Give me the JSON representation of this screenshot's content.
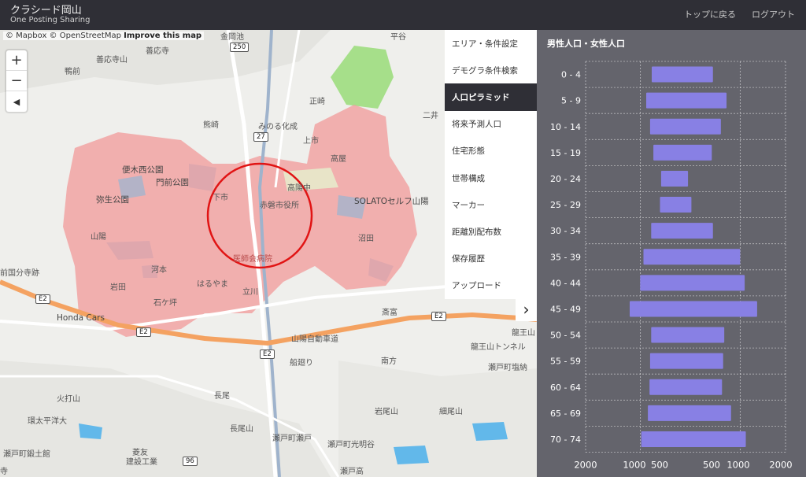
{
  "header": {
    "title": "クラシード岡山",
    "subtitle": "One Posting Sharing",
    "nav": [
      "トップに戻る",
      "ログアウト"
    ]
  },
  "map": {
    "attribution": {
      "mapbox": "© Mapbox",
      "osm": "© OpenStreetMap",
      "improve": "Improve this map"
    },
    "zoom": {
      "in": "+",
      "out": "−",
      "compass": "◀"
    },
    "labels": {
      "l1": "善応寺山",
      "l2": "善応寺",
      "l3": "鴨前",
      "l4": "250",
      "l5": "正崎",
      "l6": "熊崎",
      "l7": "みのる化成",
      "l8": "27",
      "l9": "上市",
      "l10": "高屋",
      "l11": "便木西公園",
      "l12": "門前公園",
      "l13": "弥生公園",
      "l14": "下市",
      "l15": "赤磐市役所",
      "l16": "高陽中",
      "l17": "SOLATOセルフ山陽",
      "l18": "山陽",
      "l19": "沼田",
      "l20": "河本",
      "l21": "医師会病院",
      "l22": "岩田",
      "l23": "はるやま",
      "l24": "前国分寺跡",
      "l25": "E2",
      "l26": "石ケ坪",
      "l27": "立川",
      "l28": "Honda Cars",
      "l29": "斎富",
      "l30": "E2",
      "l31": "山陽自動車道",
      "l32": "E2",
      "l33": "E2",
      "l34": "船廻り",
      "l35": "南方",
      "l36": "瀬戸町塩納",
      "l37": "長尾",
      "l38": "火打山",
      "l39": "環太平洋大",
      "l40": "長尾山",
      "l41": "岩尾山",
      "l42": "細尾山",
      "l43": "瀬戸町瀬戸",
      "l44": "瀬戸町光明谷",
      "l45": "瀬戸町鍛土館",
      "l46": "菱友",
      "l47": "建設工業",
      "l48": "96",
      "l49": "瀬戸高",
      "l50": "寺",
      "l51": "龍王山",
      "l52": "龍王山トンネル",
      "l53": "二井",
      "l54": "平谷",
      "l55": "金岡池"
    }
  },
  "menu": {
    "items": [
      "エリア・条件設定",
      "デモグラ条件検索",
      "人口ピラミッド",
      "将来予測人口",
      "住宅形態",
      "世帯構成",
      "マーカー",
      "距離別配布数",
      "保存履歴",
      "アップロード"
    ],
    "active_index": 2,
    "collapse_icon": "›"
  },
  "pyramid": {
    "title": "男性人口・女性人口"
  },
  "chart_data": {
    "type": "bar",
    "title": "男性人口・女性人口",
    "categories": [
      "0 - 4",
      "5 - 9",
      "10 - 14",
      "15 - 19",
      "20 - 24",
      "25 - 29",
      "30 - 34",
      "35 - 39",
      "40 - 44",
      "45 - 49",
      "50 - 54",
      "55 - 59",
      "60 - 64",
      "65 - 69",
      "70 - 74"
    ],
    "series": [
      {
        "values": [
          550,
          650,
          580,
          520,
          380,
          400,
          560,
          700,
          760,
          950,
          560,
          580,
          590,
          620,
          740
        ]
      },
      {
        "values": [
          1080,
          1320,
          1220,
          1060,
          640,
          700,
          1080,
          1560,
          1640,
          1860,
          1280,
          1260,
          1240,
          1400,
          1660
        ]
      }
    ],
    "x_ticks": [
      "2000",
      "1000",
      "500",
      "500",
      "1000",
      "2000"
    ],
    "bar_color": "#8880e4",
    "grid": true
  }
}
